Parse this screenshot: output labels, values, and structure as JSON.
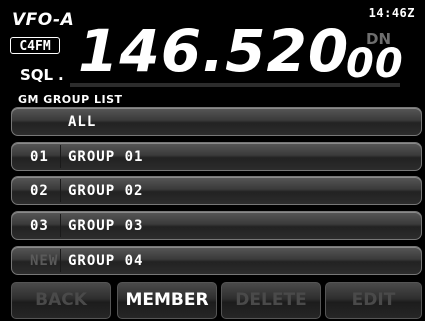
{
  "header": {
    "vfo": "VFO-A",
    "mode": "C4FM",
    "time": "14:46Z",
    "dn": "DN",
    "frequency_main": "146.520",
    "frequency_small": "00",
    "sql": "SQL",
    "sql_dot": "."
  },
  "list": {
    "title": "GM  GROUP LIST",
    "all_label": "ALL",
    "groups": [
      {
        "num": "01",
        "name": "GROUP 01",
        "dim": false
      },
      {
        "num": "02",
        "name": "GROUP 02",
        "dim": false
      },
      {
        "num": "03",
        "name": "GROUP 03",
        "dim": false
      },
      {
        "num": "NEW",
        "name": "GROUP 04",
        "dim": true
      }
    ]
  },
  "buttons": {
    "back": "BACK",
    "member": "MEMBER",
    "delete": "DELETE",
    "edit": "EDIT"
  }
}
